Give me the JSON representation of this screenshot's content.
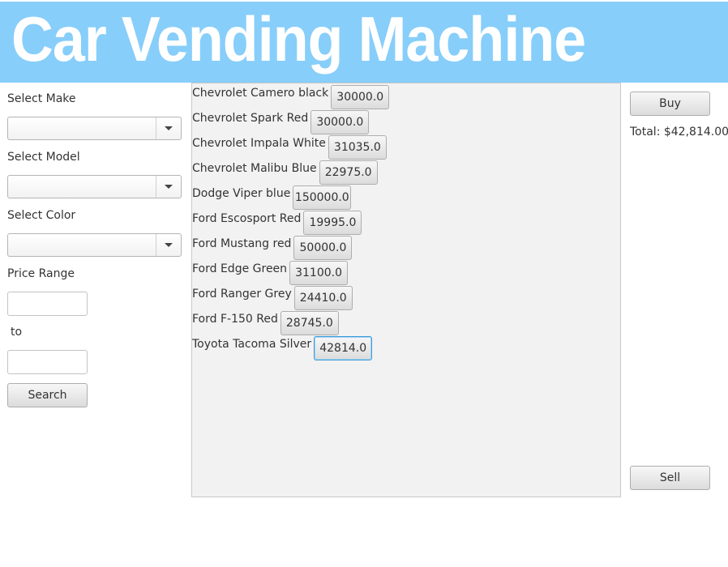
{
  "header": {
    "title": "Car Vending Machine"
  },
  "filters": {
    "make_label": "Select Make",
    "make_value": "",
    "model_label": "Select Model",
    "model_value": "",
    "color_label": "Select Color",
    "color_value": "",
    "price_range_label": "Price Range",
    "price_min": "",
    "to_label": "to",
    "price_max": "",
    "search_label": "Search"
  },
  "cars": [
    {
      "name": "Chevrolet Camero black",
      "price": "30000.0"
    },
    {
      "name": "Chevrolet Spark Red",
      "price": "30000.0"
    },
    {
      "name": "Chevrolet Impala White",
      "price": "31035.0"
    },
    {
      "name": "Chevrolet Malibu Blue",
      "price": "22975.0"
    },
    {
      "name": "Dodge Viper blue",
      "price": "150000.0"
    },
    {
      "name": "Ford Escosport Red",
      "price": "19995.0"
    },
    {
      "name": "Ford Mustang red",
      "price": "50000.0"
    },
    {
      "name": "Ford Edge Green",
      "price": "31100.0"
    },
    {
      "name": "Ford Ranger Grey",
      "price": "24410.0"
    },
    {
      "name": "Ford F-150 Red",
      "price": "28745.0"
    },
    {
      "name": "Toyota Tacoma Silver",
      "price": "42814.0"
    }
  ],
  "actions": {
    "buy_label": "Buy",
    "total": "Total: $42,814.00",
    "sell_label": "Sell"
  },
  "colors": {
    "banner": "#87cefa",
    "focus": "#3c9ad6"
  }
}
